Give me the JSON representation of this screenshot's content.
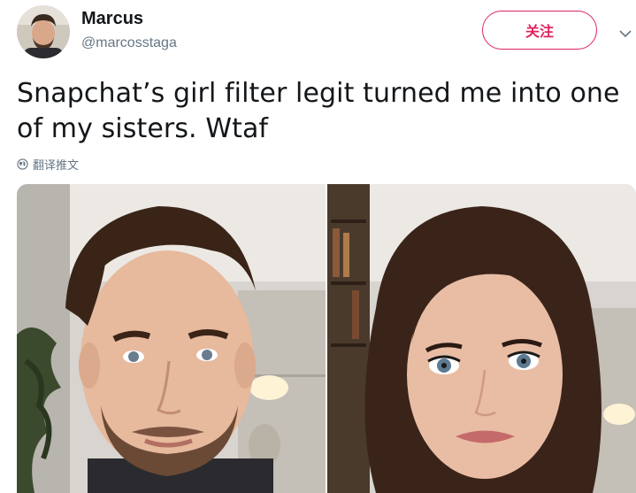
{
  "user": {
    "name": "Marcus",
    "handle": "@marcosstaga"
  },
  "follow_label": "关注",
  "tweet": {
    "text_line1": "Snapchat’s girl filter legit turned me into one",
    "text_line2": "of my sisters. Wtaf",
    "translate_label": "翻译推文"
  },
  "icons": {
    "caret": "chevron-down-icon",
    "translate": "globe-icon"
  },
  "colors": {
    "accent": "#e0245e",
    "secondary_text": "#657786",
    "primary_text": "#14171a"
  }
}
